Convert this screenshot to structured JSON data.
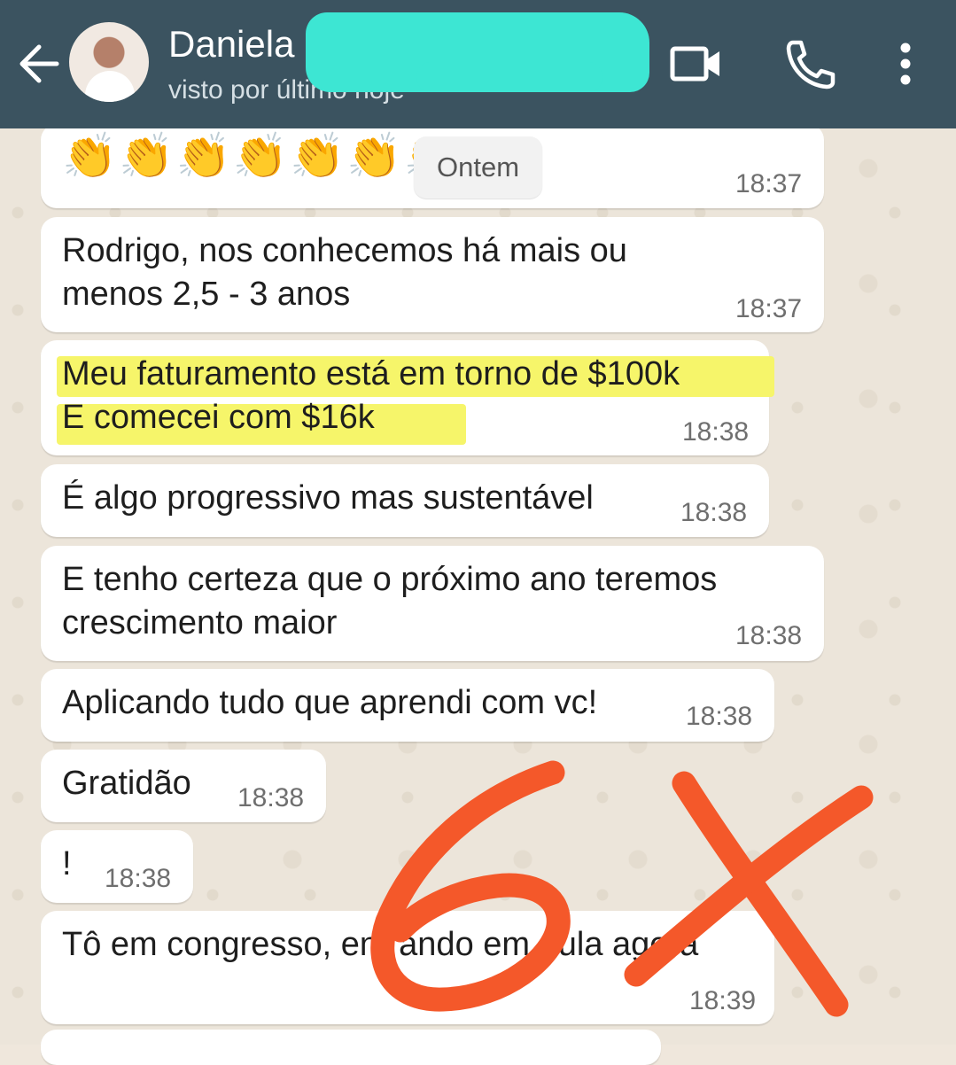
{
  "header": {
    "contact_name": "Daniela",
    "last_seen": "visto por último hoje",
    "icons": [
      "back-arrow-icon",
      "video-call-icon",
      "phone-icon",
      "more-vert-icon"
    ]
  },
  "date_separator": "Ontem",
  "messages": [
    {
      "text": "👏👏👏👏👏👏👏",
      "time": "18:37"
    },
    {
      "line1": "Rodrigo, nos conhecemos há mais ou",
      "line2": "menos 2,5 - 3 anos",
      "time": "18:37"
    },
    {
      "line1": "Meu faturamento está em torno de $100k",
      "line2": "E comecei com $16k",
      "time": "18:38"
    },
    {
      "text": "É algo progressivo mas sustentável",
      "time": "18:38"
    },
    {
      "line1": "E tenho certeza que o próximo ano teremos",
      "line2": "crescimento maior",
      "time": "18:38"
    },
    {
      "text": "Aplicando tudo que aprendi com vc!",
      "time": "18:38"
    },
    {
      "text": "Gratidão",
      "time": "18:38"
    },
    {
      "text": "!",
      "time": "18:38"
    },
    {
      "text": "Tô em congresso, entrando em aula agora",
      "time": "18:39"
    }
  ],
  "annotation": {
    "text": "6X",
    "color": "#f4582a"
  },
  "colors": {
    "header_bg": "#3b5360",
    "redaction": "#3de6d3",
    "highlight": "#f6f56a"
  }
}
